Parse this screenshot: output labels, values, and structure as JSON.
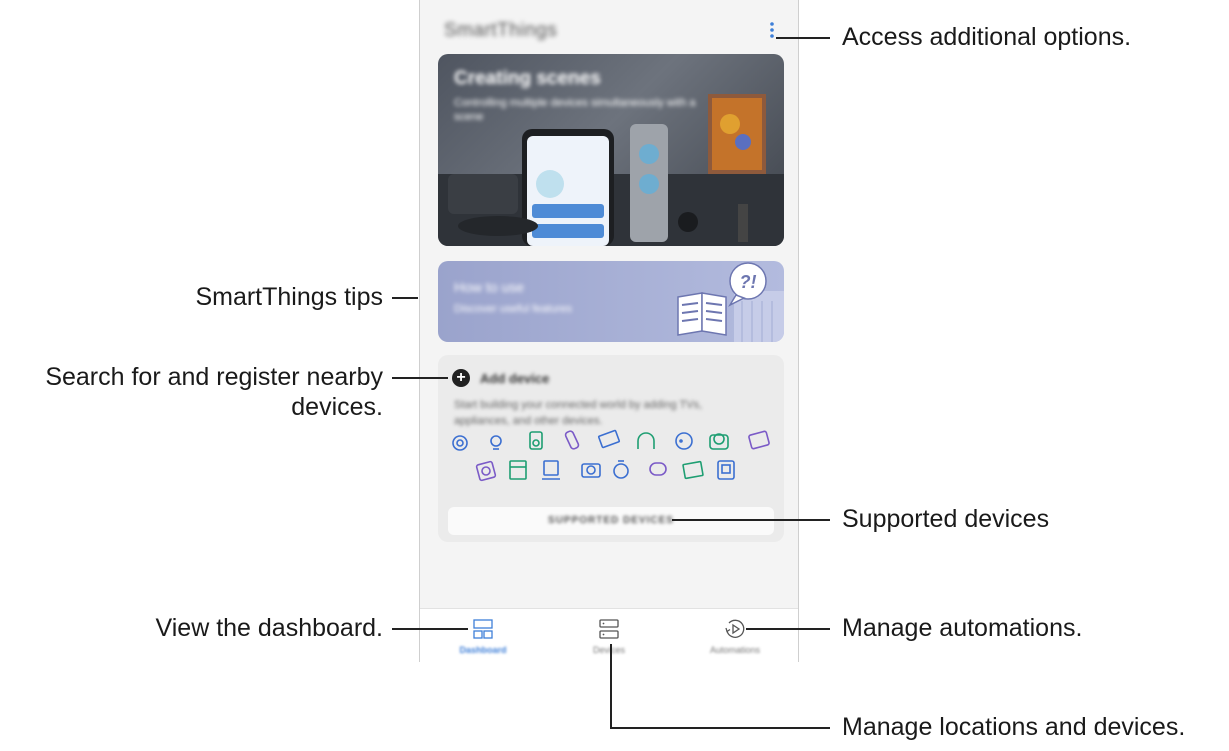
{
  "app": {
    "title": "SmartThings",
    "more_options_icon": "more-vert-icon"
  },
  "hero": {
    "title": "Creating scenes",
    "subtitle": "Controlling multiple devices simultaneously with a scene"
  },
  "tips": {
    "title": "How to use",
    "subtitle": "Discover useful features"
  },
  "add_device": {
    "label": "Add device",
    "description": "Start building your connected world by adding TVs, appliances, and other devices.",
    "supported_button": "SUPPORTED DEVICES"
  },
  "bottom_nav": {
    "items": [
      {
        "label": "Dashboard",
        "icon": "dashboard-icon",
        "active": true
      },
      {
        "label": "Devices",
        "icon": "devices-icon",
        "active": false
      },
      {
        "label": "Automations",
        "icon": "automations-icon",
        "active": false
      }
    ]
  },
  "callouts": {
    "options": "Access additional options.",
    "tips": "SmartThings tips",
    "search_line1": "Search for and register nearby",
    "search_line2": "devices.",
    "supported": "Supported devices",
    "dashboard": "View the dashboard.",
    "automations": "Manage automations.",
    "locations": "Manage locations and devices."
  },
  "colors": {
    "accent_blue": "#3e7fd8",
    "tips_card": "#a7b0d8",
    "device_icons": [
      "#3b6fd1",
      "#1e9e72",
      "#7b5bc7"
    ]
  }
}
